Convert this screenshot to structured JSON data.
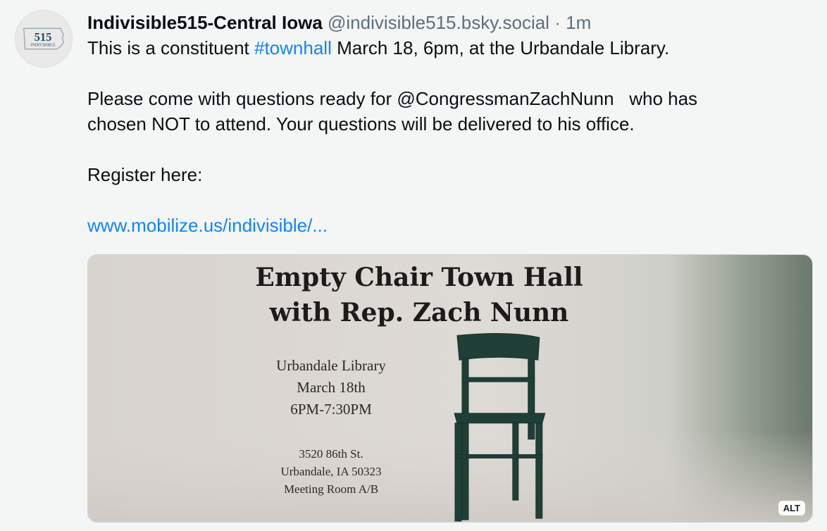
{
  "post": {
    "author": "Indivisible515-Central Iowa",
    "handle": "@indivisible515.bsky.social",
    "separator": "·",
    "time": "1m",
    "avatar": {
      "number": "515",
      "label": "INDIVISIBLE"
    },
    "line1_before": "This is a constituent ",
    "hashtag": "#townhall",
    "line1_after": " March 18, 6pm, at the Urbandale Library.",
    "para2_line1": "Please come with questions ready for @CongressmanZachNunn   who has",
    "para2_line2": "chosen NOT to attend. Your questions will be delivered to his office.",
    "register": "Register here:",
    "link": "www.mobilize.us/indivisible/..."
  },
  "image": {
    "title_line1": "Empty Chair Town Hall",
    "title_line2": "with Rep. Zach Nunn",
    "venue": "Urbandale Library",
    "date": "March 18th",
    "time": "6PM-7:30PM",
    "address1": "3520 86th St.",
    "address2": "Urbandale, IA 50323",
    "room": "Meeting Room A/B",
    "alt_badge": "ALT"
  }
}
